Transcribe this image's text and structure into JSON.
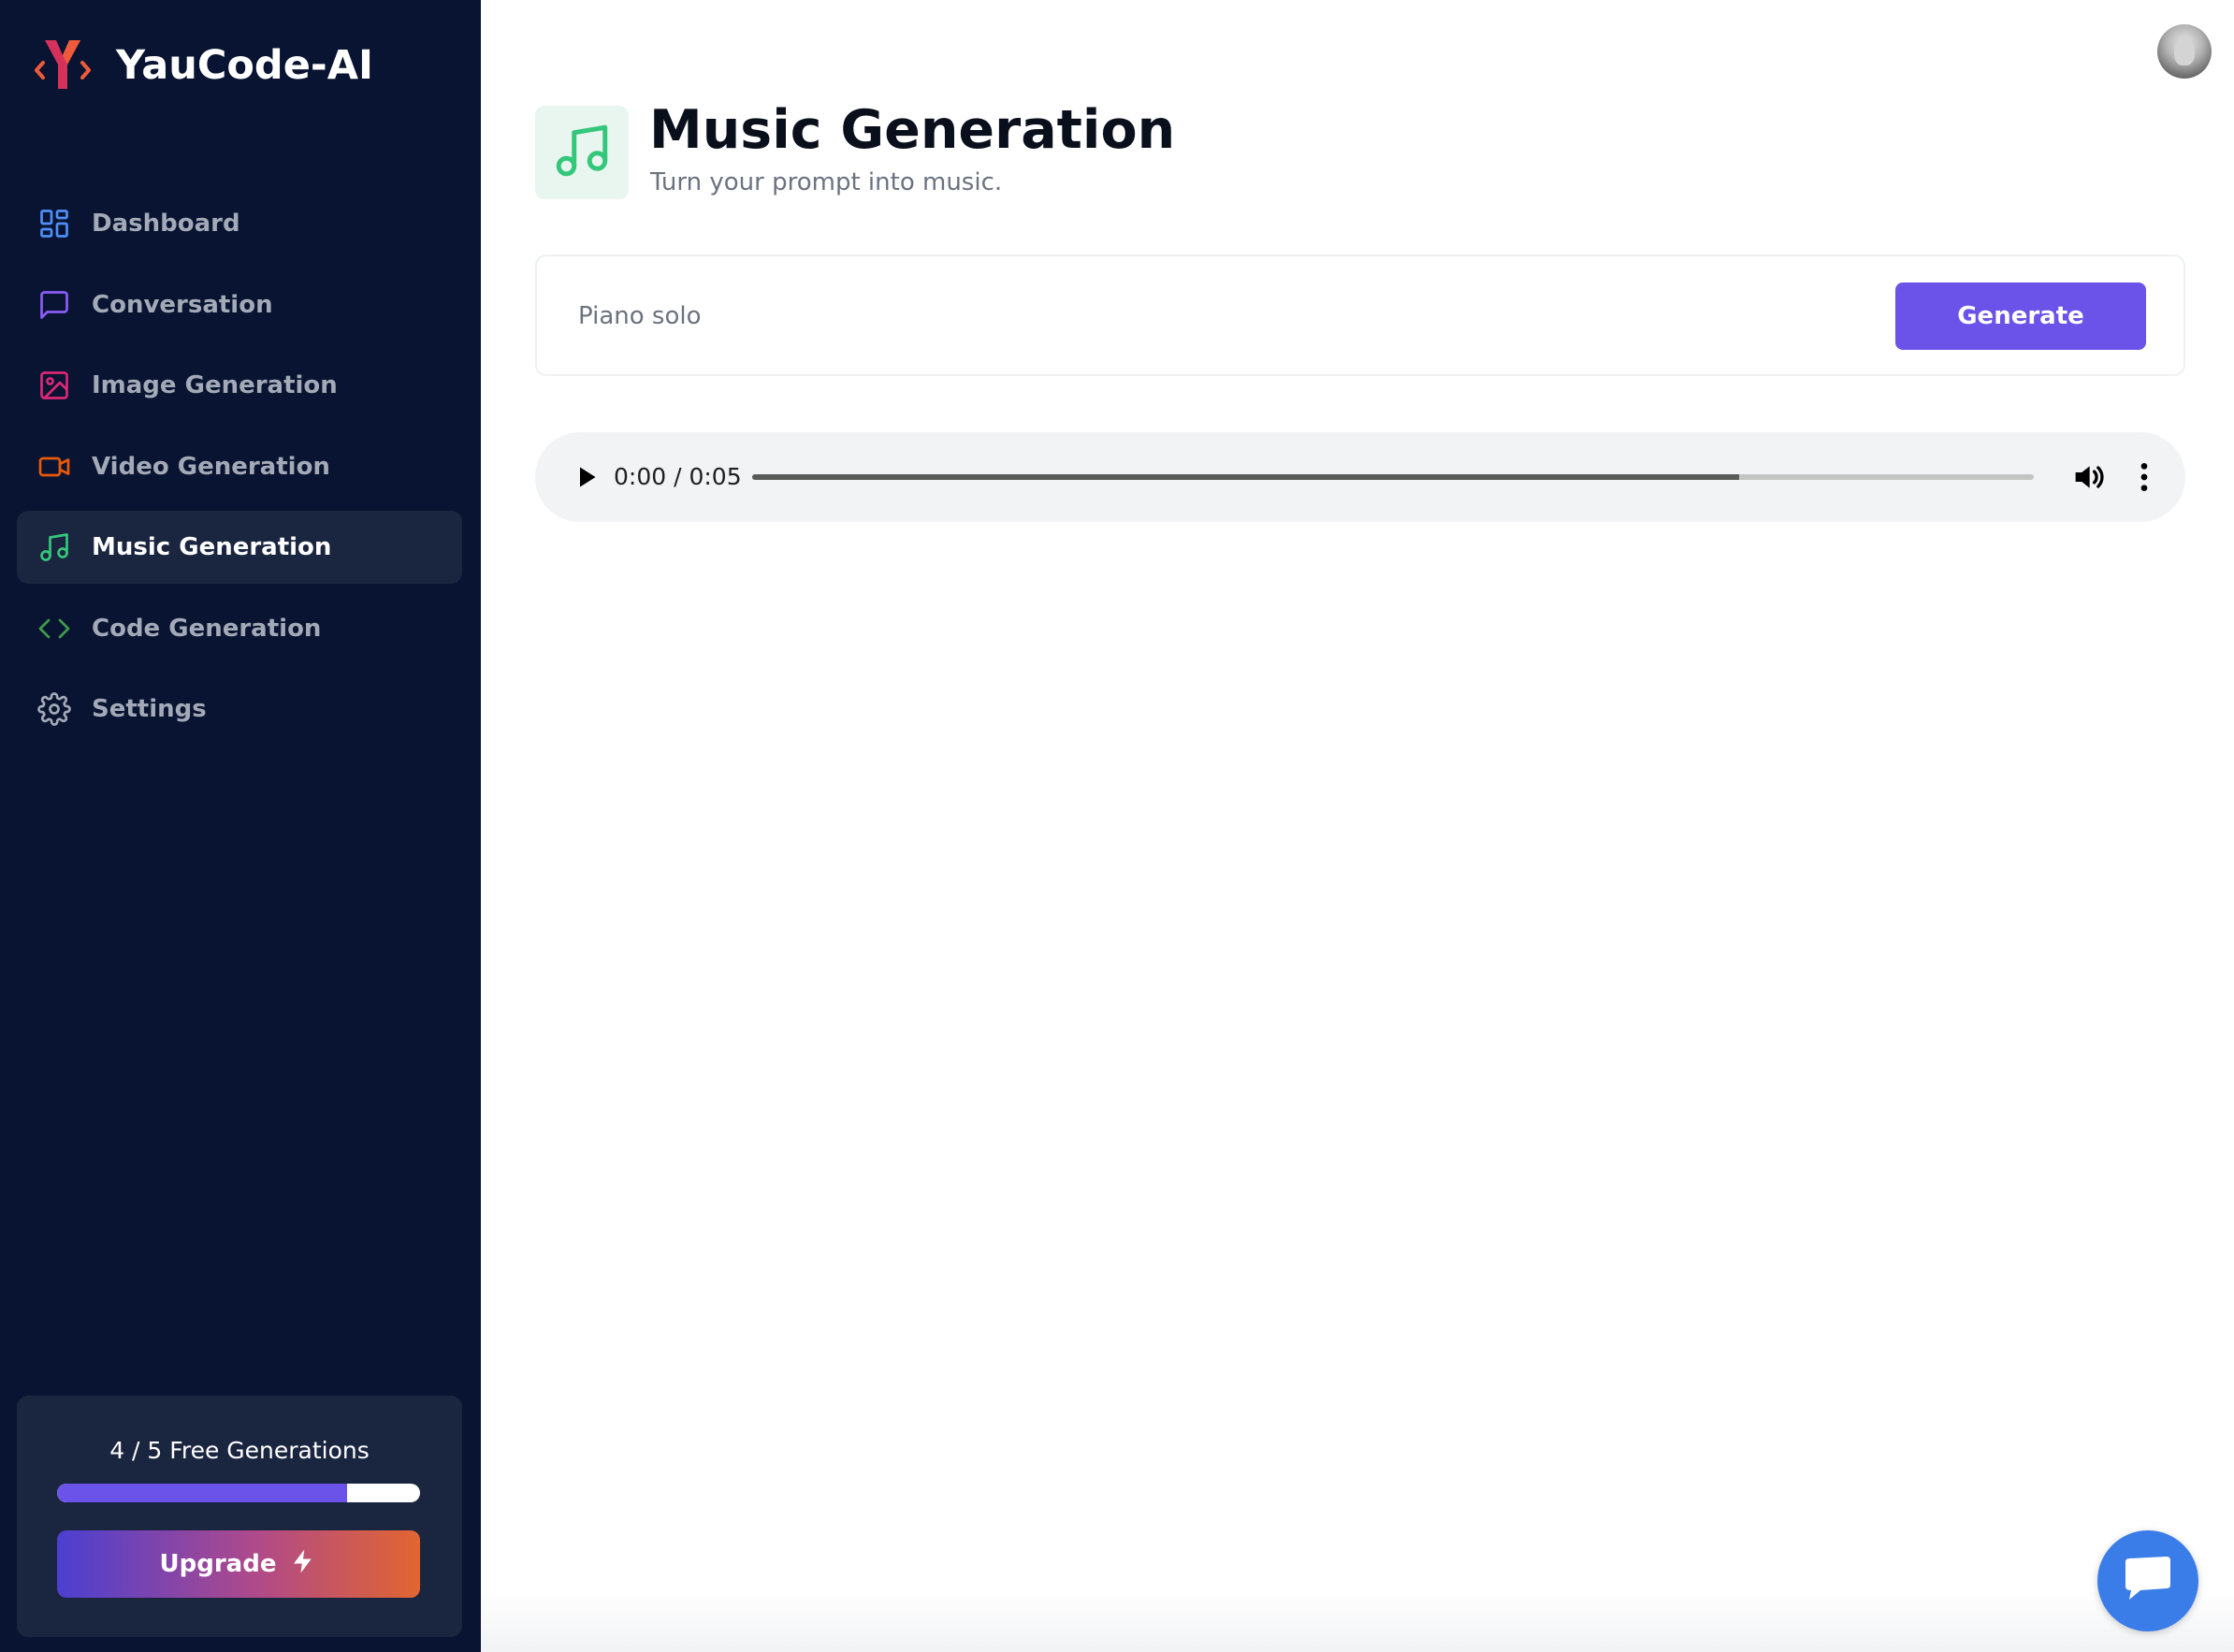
{
  "brand": {
    "name": "YauCode-AI",
    "logo_icon": "yaucode-logo"
  },
  "sidebar": {
    "items": [
      {
        "label": "Dashboard",
        "icon": "dashboard-icon",
        "color": "#4f8ef7"
      },
      {
        "label": "Conversation",
        "icon": "message-square-icon",
        "color": "#8b5cf6"
      },
      {
        "label": "Image Generation",
        "icon": "image-icon",
        "color": "#db2777"
      },
      {
        "label": "Video Generation",
        "icon": "video-icon",
        "color": "#ea580c"
      },
      {
        "label": "Music Generation",
        "icon": "music-icon",
        "color": "#34c77b",
        "active": true
      },
      {
        "label": "Code Generation",
        "icon": "code-icon",
        "color": "#3f9b4a"
      },
      {
        "label": "Settings",
        "icon": "settings-icon",
        "color": "#a3a9b6"
      }
    ]
  },
  "credits": {
    "text": "4 / 5 Free Generations",
    "used": 4,
    "total": 5,
    "upgrade_label": "Upgrade",
    "upgrade_icon": "lightning-icon"
  },
  "header": {
    "title": "Music Generation",
    "subtitle": "Turn your prompt into music.",
    "icon": "music-icon",
    "icon_color": "#34c77b",
    "icon_bg": "#e9f6ef"
  },
  "prompt": {
    "value": "",
    "placeholder": "Piano solo",
    "button_label": "Generate"
  },
  "audio_player": {
    "time": "0:00 / 0:05",
    "buffered_fraction": 0.77,
    "icons": [
      "play-icon",
      "volume-icon",
      "more-vertical-icon"
    ]
  },
  "colors": {
    "sidebar_bg": "#081431",
    "accent": "#6b52e8",
    "chat_fab": "#3b7de8"
  }
}
